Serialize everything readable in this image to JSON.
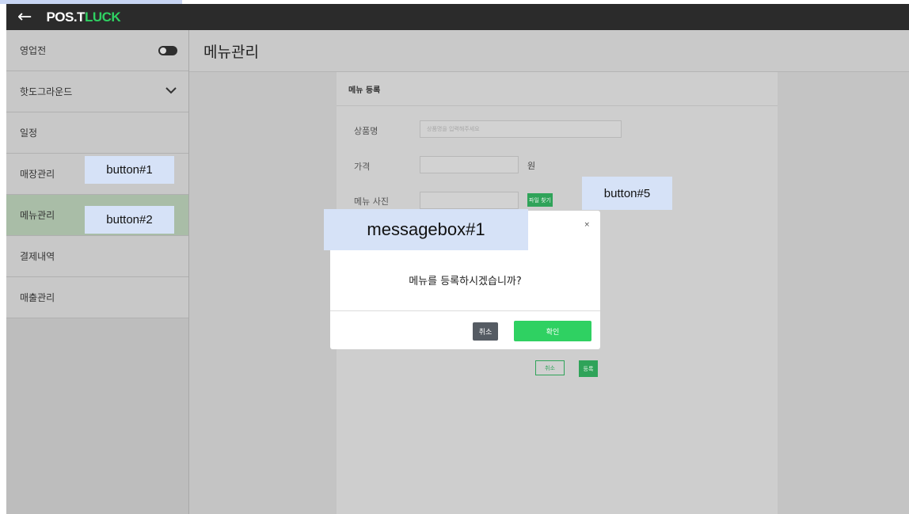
{
  "topbar": {
    "back_icon": "←",
    "logo_white": "POS.T",
    "logo_green": "LUCK"
  },
  "sidebar": {
    "items": [
      {
        "label": "영업전"
      },
      {
        "label": "핫도그라운드"
      },
      {
        "label": "일정"
      },
      {
        "label": "매장관리"
      },
      {
        "label": "메뉴관리"
      },
      {
        "label": "결제내역"
      },
      {
        "label": "매출관리"
      }
    ]
  },
  "main": {
    "title": "메뉴관리",
    "card": {
      "title": "메뉴 등록",
      "product_label": "상품명",
      "product_placeholder": "상품명을 입력해주세요",
      "price_label": "가격",
      "price_unit": "원",
      "photo_label": "메뉴 사진",
      "file_button": "파일 찾기",
      "cancel_button": "취소",
      "register_button": "등록"
    }
  },
  "modal": {
    "close": "×",
    "message": "메뉴를 등록하시겠습니까?",
    "cancel": "취소",
    "confirm": "확인"
  },
  "annotations": {
    "button1": "button#1",
    "button2": "button#2",
    "button5": "button#5",
    "messagebox1": "messagebox#1"
  },
  "colors": {
    "accent_green": "#2fd162",
    "topbar": "#2b2b2b",
    "annotation_bg": "#d6e2f7"
  }
}
